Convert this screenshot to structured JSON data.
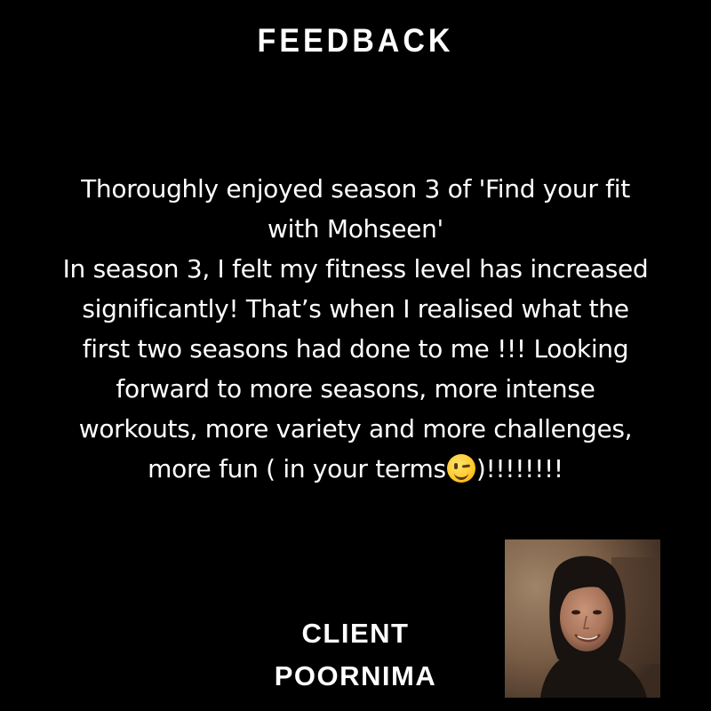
{
  "header": {
    "title": "FEEDBACK"
  },
  "testimonial": {
    "lines": [
      "Thoroughly enjoyed season 3 of 'Find your fit",
      "with Mohseen'",
      "In season 3, I felt my fitness level has increased",
      "significantly! That’s when I realised what the",
      "first two seasons had done to me !!! Looking",
      "forward to more seasons, more intense",
      "workouts, more variety and more challenges,"
    ],
    "last_line_before_emoji": "more fun ( in your terms",
    "emoji": "winking-face-emoji",
    "last_line_after_emoji": ")!!!!!!!!"
  },
  "client": {
    "role": "CLIENT",
    "name": "POORNIMA"
  },
  "colors": {
    "background": "#000000",
    "text": "#ffffff"
  }
}
